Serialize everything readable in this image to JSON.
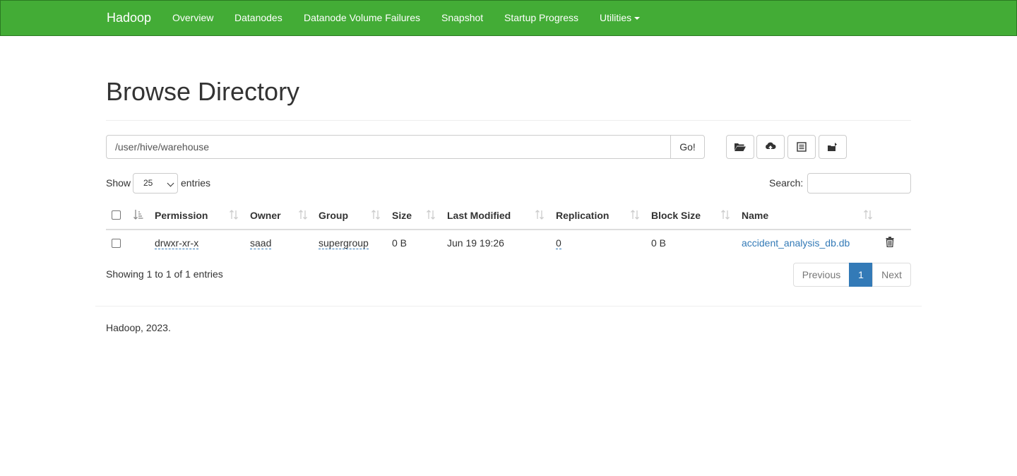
{
  "navbar": {
    "brand": "Hadoop",
    "items": [
      {
        "label": "Overview"
      },
      {
        "label": "Datanodes"
      },
      {
        "label": "Datanode Volume Failures"
      },
      {
        "label": "Snapshot"
      },
      {
        "label": "Startup Progress"
      },
      {
        "label": "Utilities"
      }
    ],
    "color": "#43ac36"
  },
  "page": {
    "title": "Browse Directory"
  },
  "toolbar": {
    "path_value": "/user/hive/warehouse",
    "go_label": "Go!",
    "buttons": [
      "folder-open-icon",
      "upload-icon",
      "list-icon",
      "cut-paste-icon"
    ]
  },
  "table_controls": {
    "show_label": "Show",
    "entries_selected": "25",
    "entries_label": "entries",
    "search_label": "Search:"
  },
  "table": {
    "columns": [
      "Permission",
      "Owner",
      "Group",
      "Size",
      "Last Modified",
      "Replication",
      "Block Size",
      "Name"
    ],
    "rows": [
      {
        "permission": "drwxr-xr-x",
        "owner": "saad",
        "group": "supergroup",
        "size": "0 B",
        "last_modified": "Jun 19 19:26",
        "replication": "0",
        "block_size": "0 B",
        "name": "accident_analysis_db.db"
      }
    ]
  },
  "pagination": {
    "info": "Showing 1 to 1 of 1 entries",
    "previous": "Previous",
    "current": "1",
    "next": "Next",
    "active_color": "#337ab7"
  },
  "footer": {
    "text": "Hadoop, 2023."
  }
}
